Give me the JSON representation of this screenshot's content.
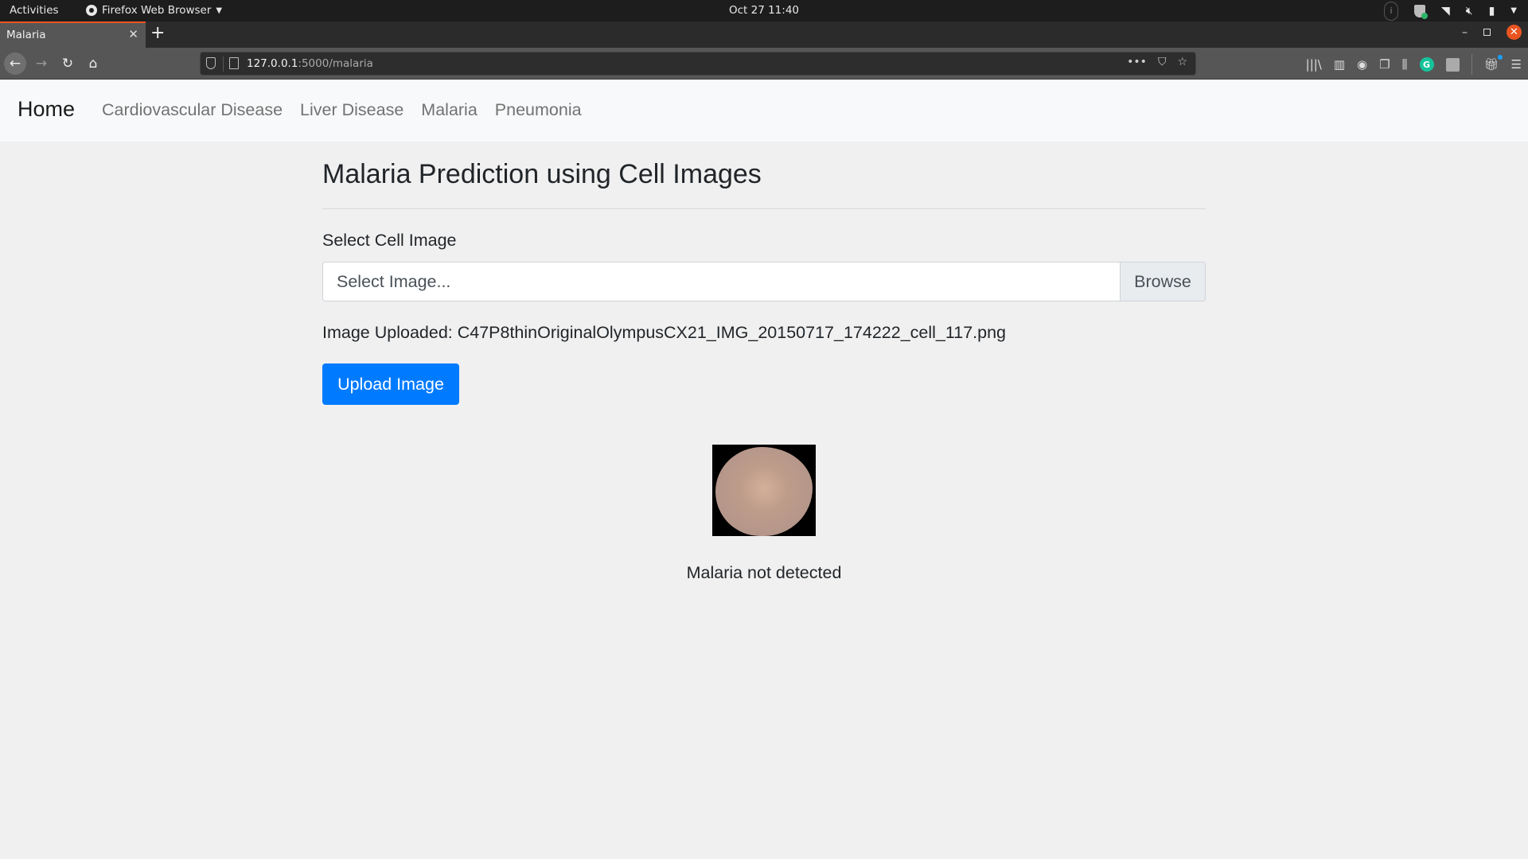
{
  "os_topbar": {
    "activities": "Activities",
    "app_menu": "Firefox Web Browser",
    "clock": "Oct 27  11:40"
  },
  "browser": {
    "tab_title": "Malaria",
    "url_host": "127.0.0.1",
    "url_rest": ":5000/malaria",
    "page_actions": "•••"
  },
  "site_nav": {
    "brand": "Home",
    "links": [
      {
        "label": "Cardiovascular Disease"
      },
      {
        "label": "Liver Disease"
      },
      {
        "label": "Malaria"
      },
      {
        "label": "Pneumonia"
      }
    ]
  },
  "main": {
    "title": "Malaria Prediction using Cell Images",
    "field_label": "Select Cell Image",
    "file_input": {
      "placeholder": "Select Image...",
      "browse_label": "Browse"
    },
    "uploaded_text": "Image Uploaded: C47P8thinOriginalOlympusCX21_IMG_20150717_174222_cell_117.png",
    "upload_button": "Upload Image",
    "result": "Malaria not detected"
  },
  "colors": {
    "primary": "#007bff",
    "ubuntu_accent": "#e95420",
    "grammarly": "#15c39a"
  }
}
